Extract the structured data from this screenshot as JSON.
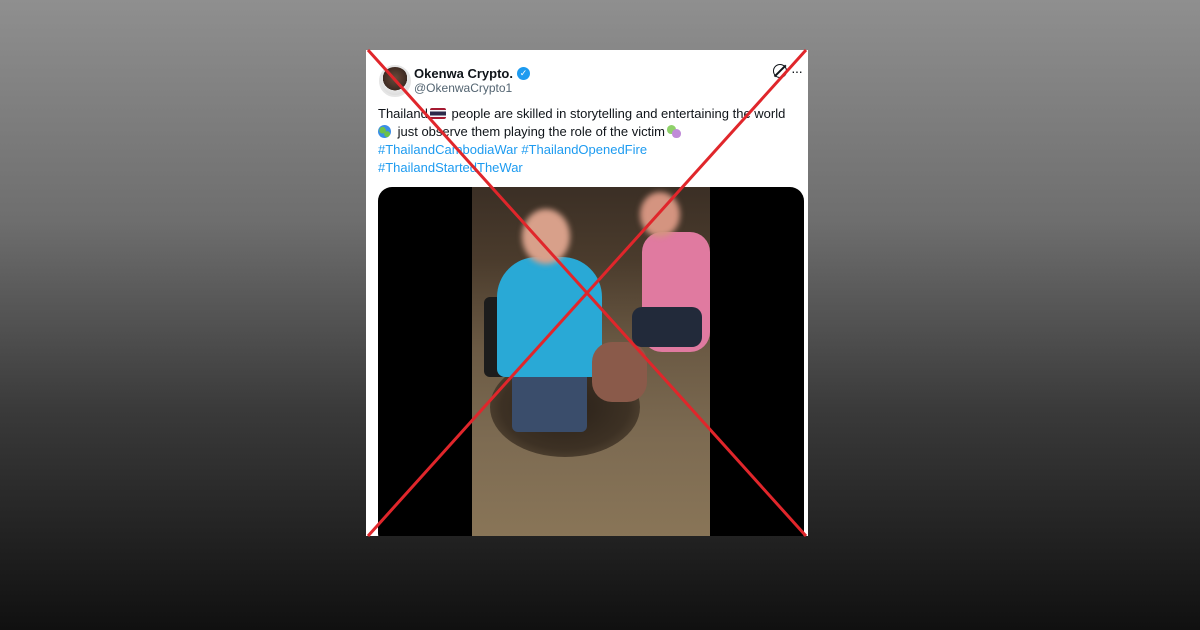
{
  "post": {
    "author_name": "Okenwa Crypto.",
    "author_handle": "@OkenwaCrypto1",
    "text_part1": "Thailand",
    "text_part2": " people are skilled in storytelling and entertaining the world",
    "text_part3": " just observe them playing the role of the victim",
    "hashtags": [
      "#ThailandCambodiaWar",
      "#ThailandOpenedFire",
      "#ThailandStartedTheWar"
    ],
    "icons": {
      "verified": "verified-badge-icon",
      "grok": "grok-icon",
      "more": "more-options-icon",
      "flag": "thailand-flag-emoji",
      "globe": "globe-emoji",
      "masks": "performing-arts-emoji"
    }
  },
  "overlay": {
    "mark": "red-cross-out",
    "color": "#e0262b"
  }
}
